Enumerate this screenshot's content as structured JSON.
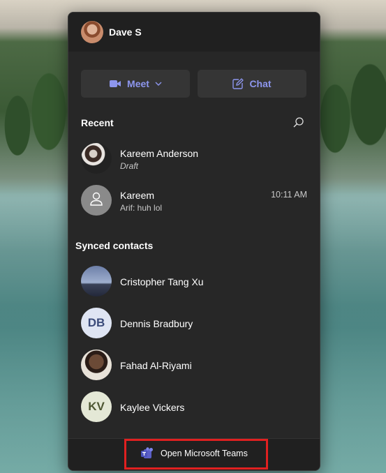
{
  "header": {
    "user_name": "Dave S"
  },
  "actions": {
    "meet_label": "Meet",
    "chat_label": "Chat"
  },
  "recent": {
    "title": "Recent",
    "items": [
      {
        "name": "Kareem Anderson",
        "subtitle": "Draft",
        "time": ""
      },
      {
        "name": "Kareem",
        "subtitle": "Arif: huh lol",
        "time": "10:11 AM"
      }
    ]
  },
  "contacts": {
    "title": "Synced contacts",
    "items": [
      {
        "name": "Cristopher Tang Xu",
        "initials": ""
      },
      {
        "name": "Dennis Bradbury",
        "initials": "DB"
      },
      {
        "name": "Fahad Al-Riyami",
        "initials": ""
      },
      {
        "name": "Kaylee Vickers",
        "initials": "KV"
      }
    ]
  },
  "footer": {
    "open_teams_label": "Open Microsoft Teams"
  },
  "colors": {
    "accent": "#8d96ee",
    "highlight": "#e02020",
    "panel": "#272727"
  }
}
